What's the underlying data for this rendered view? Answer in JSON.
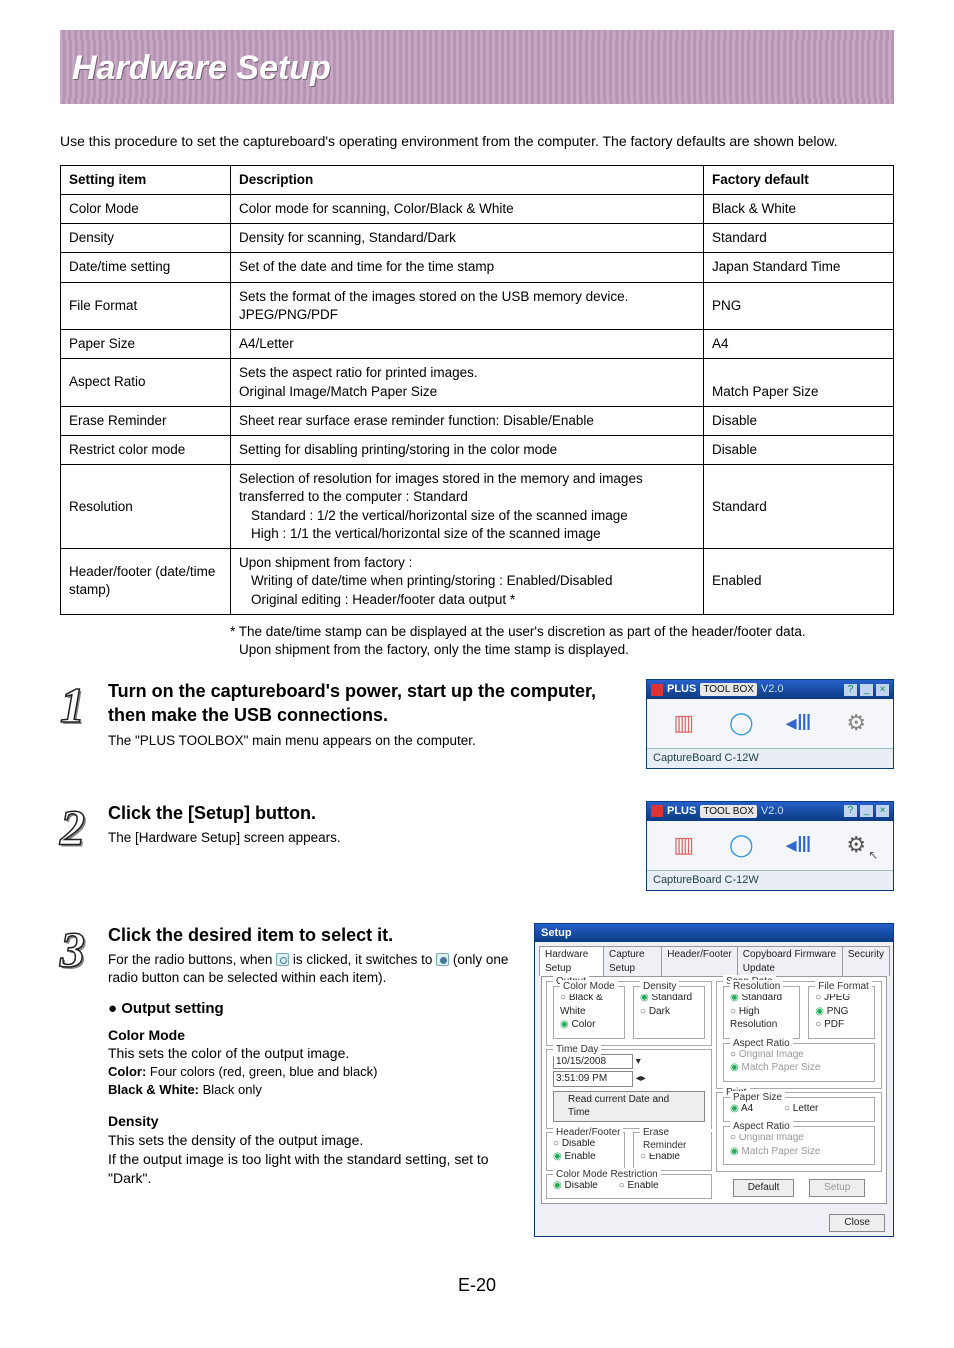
{
  "banner": {
    "title": "Hardware Setup"
  },
  "intro": "Use this procedure to set the captureboard's operating environment from the computer. The factory defaults are shown below.",
  "table": {
    "head": {
      "c1": "Setting item",
      "c2": "Description",
      "c3": "Factory default"
    },
    "rows": [
      {
        "c1": "Color Mode",
        "c2": "Color mode for scanning, Color/Black & White",
        "c3": "Black & White"
      },
      {
        "c1": "Density",
        "c2": "Density for scanning, Standard/Dark",
        "c3": "Standard"
      },
      {
        "c1": "Date/time setting",
        "c2": "Set of the date and time for the time stamp",
        "c3": "Japan Standard Time"
      },
      {
        "c1": "File Format",
        "c2": "Sets the format of the images stored on the USB memory device.\nJPEG/PNG/PDF",
        "c3": "PNG"
      },
      {
        "c1": "Paper Size",
        "c2": "A4/Letter",
        "c3": "A4"
      },
      {
        "c1": "Aspect Ratio",
        "c2": "Sets the aspect ratio for printed images.\nOriginal Image/Match Paper Size",
        "c3": "Match Paper Size"
      },
      {
        "c1": "Erase Reminder",
        "c2": "Sheet rear surface erase reminder function: Disable/Enable",
        "c3": "Disable"
      },
      {
        "c1": "Restrict color mode",
        "c2": "Setting for disabling printing/storing in the color mode",
        "c3": "Disable"
      },
      {
        "c1": "Resolution",
        "c2a": "Selection of resolution for images stored in the memory and images transferred to the computer : Standard",
        "c2b": "Standard : 1/2 the vertical/horizontal size of the scanned image",
        "c2c": "High : 1/1 the vertical/horizontal size of the scanned image",
        "c3": "Standard"
      },
      {
        "c1": "Header/footer (date/time stamp)",
        "c2a": "Upon shipment from factory :",
        "c2b": "Writing of date/time when printing/storing : Enabled/Disabled",
        "c2c": "Original editing : Header/footer data output *",
        "c3": "Enabled"
      }
    ]
  },
  "footnote": {
    "l1": "* The date/time stamp can be displayed at the user's discretion as part of the header/footer data.",
    "l2": "Upon shipment from the factory, only the time stamp is displayed."
  },
  "steps": {
    "s1": {
      "num": "1",
      "title": "Turn on the captureboard's power, start up the computer, then make the USB connections.",
      "sub": "The \"PLUS TOOLBOX\" main menu appears on the computer."
    },
    "s2": {
      "num": "2",
      "title": "Click the [Setup] button.",
      "sub": "The [Hardware Setup] screen appears."
    },
    "s3": {
      "num": "3",
      "title": "Click the desired item to select it.",
      "sub1": "For the radio buttons, when ",
      "sub2": " is clicked, it switches to ",
      "sub3": " (only one radio button can be selected within each item)."
    }
  },
  "output_setting": {
    "heading": "Output setting",
    "color_mode": {
      "title": "Color Mode",
      "desc": "This sets the color of the output image.",
      "opt1_label": "Color:",
      "opt1_val": " Four colors (red, green, blue and black)",
      "opt2_label": "Black & White:",
      "opt2_val": " Black only"
    },
    "density": {
      "title": "Density",
      "desc1": "This sets the density of the output image.",
      "desc2": "If the output image is too light with the standard setting, set to \"Dark\"."
    }
  },
  "toolbox_window": {
    "title_left": "PLUS",
    "title_right": "TOOL BOX",
    "version": "V2.0",
    "status": "CaptureBoard C-12W"
  },
  "setup_dialog": {
    "title": "Setup",
    "tabs": [
      "Hardware Setup",
      "Capture Setup",
      "Header/Footer",
      "Copyboard Firmware Update",
      "Security"
    ],
    "output": {
      "legend": "Output",
      "colormode": {
        "legend": "Color Mode",
        "opt1": "Black & White",
        "opt2": "Color"
      },
      "density": {
        "legend": "Density",
        "opt1": "Standard",
        "opt2": "Dark"
      }
    },
    "timeday": {
      "legend": "Time Day",
      "date": "10/15/2008",
      "time": "3:51:09 PM",
      "btn": "Read current Date and Time"
    },
    "headerfooter": {
      "legend": "Header/Footer",
      "opt1": "Disable",
      "opt2": "Enable"
    },
    "erase": {
      "legend": "Erase Reminder",
      "opt1": "Disable",
      "opt2": "Enable"
    },
    "cmr": {
      "legend": "Color Mode Restriction",
      "opt1": "Disable",
      "opt2": "Enable"
    },
    "scan": {
      "legend": "Scan Data",
      "res": {
        "legend": "Resolution",
        "opt1": "Standard",
        "opt2": "High Resolution"
      },
      "ff": {
        "legend": "File Format",
        "opt1": "JPEG",
        "opt2": "PNG",
        "opt3": "PDF"
      },
      "ar": {
        "legend": "Aspect Ratio",
        "opt1": "Original Image",
        "opt2": "Match Paper Size"
      }
    },
    "print": {
      "legend": "Print",
      "ps": {
        "legend": "Paper Size",
        "opt1": "A4",
        "opt2": "Letter"
      },
      "ar": {
        "legend": "Aspect Ratio",
        "opt1": "Original Image",
        "opt2": "Match Paper Size"
      }
    },
    "buttons": {
      "default": "Default",
      "setup": "Setup",
      "close": "Close"
    }
  },
  "page_number": "E-20"
}
